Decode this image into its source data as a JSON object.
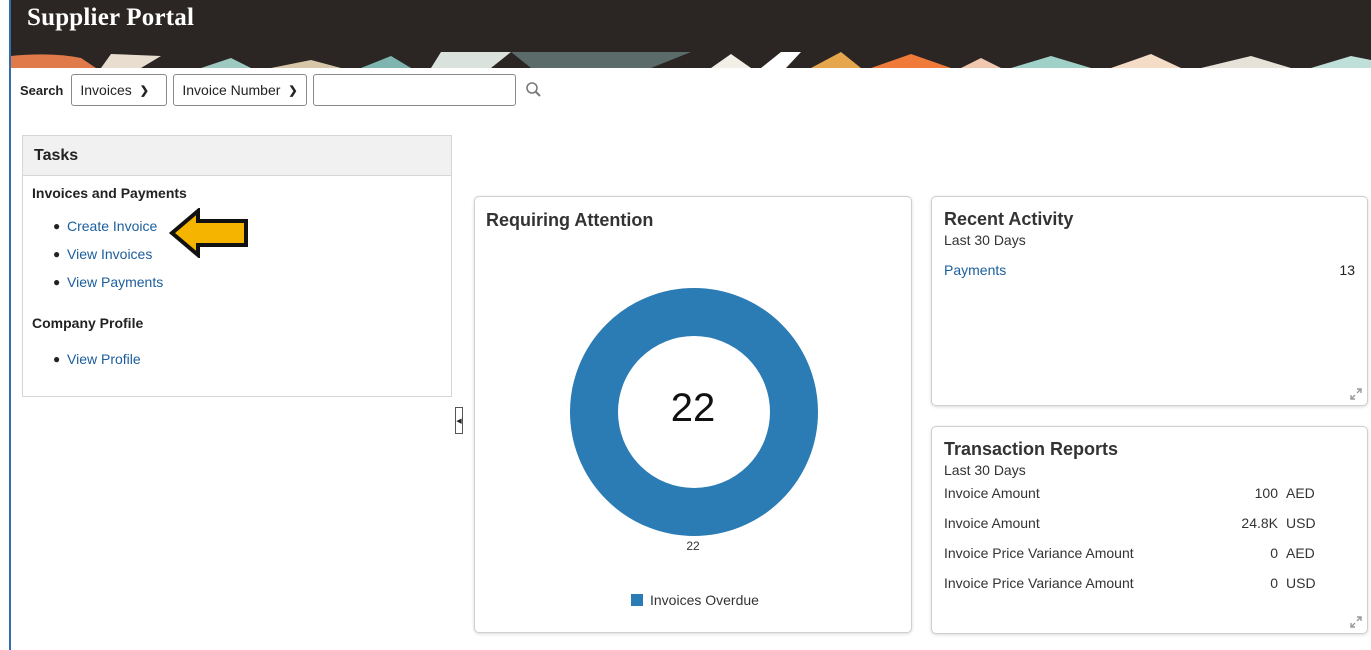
{
  "header": {
    "title": "Supplier Portal"
  },
  "search": {
    "label": "Search",
    "category": "Invoices",
    "field": "Invoice Number",
    "value": ""
  },
  "tasks": {
    "title": "Tasks",
    "sections": [
      {
        "title": "Invoices and Payments",
        "items": [
          "Create Invoice",
          "View Invoices",
          "View Payments"
        ]
      },
      {
        "title": "Company Profile",
        "items": [
          "View Profile"
        ]
      }
    ]
  },
  "requiring_attention": {
    "title": "Requiring Attention",
    "center_value": "22",
    "slice_label": "22",
    "legend": "Invoices Overdue",
    "color": "#2b7bb5"
  },
  "chart_data": {
    "type": "pie",
    "categories": [
      "Invoices Overdue"
    ],
    "values": [
      22
    ],
    "title": "Requiring Attention"
  },
  "recent_activity": {
    "title": "Recent Activity",
    "subtitle": "Last 30 Days",
    "rows": [
      {
        "label": "Payments",
        "value": "13"
      }
    ]
  },
  "transaction_reports": {
    "title": "Transaction Reports",
    "subtitle": "Last 30 Days",
    "rows": [
      {
        "label": "Invoice Amount",
        "value": "100",
        "currency": "AED"
      },
      {
        "label": "Invoice Amount",
        "value": "24.8K",
        "currency": "USD"
      },
      {
        "label": "Invoice Price Variance Amount",
        "value": "0",
        "currency": "AED"
      },
      {
        "label": "Invoice Price Variance Amount",
        "value": "0",
        "currency": "USD"
      }
    ]
  },
  "colors": {
    "header": "#2b2623",
    "link": "#1b5e9c",
    "accent_arrow": "#f5b400"
  }
}
